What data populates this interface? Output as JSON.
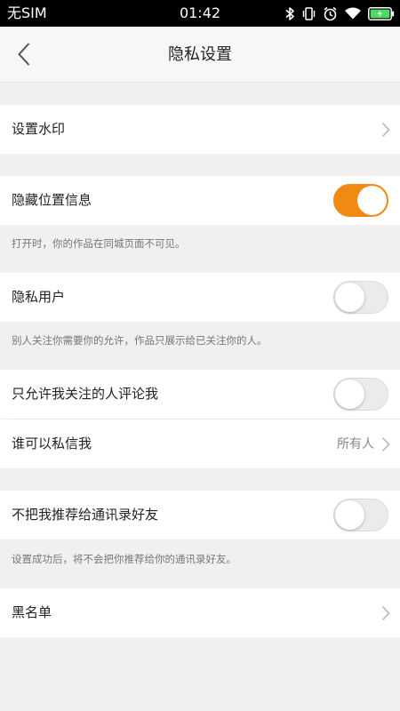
{
  "status_bar": {
    "carrier": "无SIM",
    "time": "01:42",
    "icons": [
      "bluetooth-icon",
      "vibrate-icon",
      "alarm-icon",
      "wifi-icon",
      "battery-icon"
    ],
    "battery_color": "#4cd964"
  },
  "header": {
    "title": "隐私设置",
    "back_icon": "chevron-left-icon"
  },
  "settings": {
    "watermark": {
      "label": "设置水印"
    },
    "hide_location": {
      "label": "隐藏位置信息",
      "enabled": true,
      "hint": "打开时，你的作品在同城页面不可见。"
    },
    "private_user": {
      "label": "隐私用户",
      "enabled": false,
      "hint": "别人关注你需要你的允许，作品只展示给已关注你的人。"
    },
    "comment_only_following": {
      "label": "只允许我关注的人评论我",
      "enabled": false
    },
    "who_can_message": {
      "label": "谁可以私信我",
      "value": "所有人"
    },
    "not_recommend_contacts": {
      "label": "不把我推荐给通讯录好友",
      "enabled": false,
      "hint": "设置成功后，将不会把你推荐给你的通讯录好友。"
    },
    "blacklist": {
      "label": "黑名单"
    }
  },
  "colors": {
    "accent": "#f08a12",
    "background": "#f0f0f0",
    "toggle_off": "#ebebeb"
  }
}
